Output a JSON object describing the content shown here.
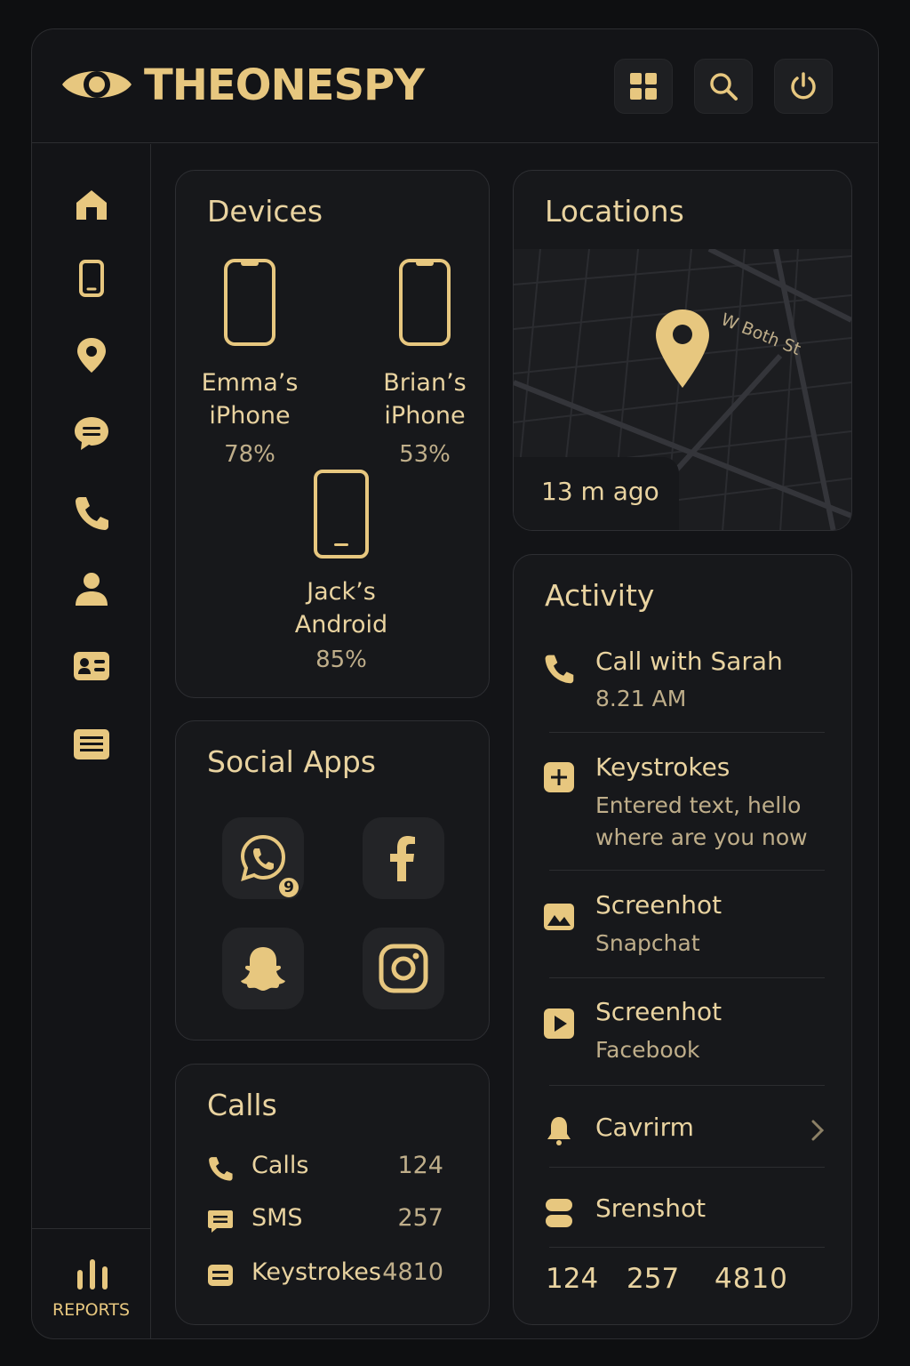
{
  "header": {
    "brand": "THEONESPY",
    "icons": [
      "eye-logo-icon",
      "grid-icon",
      "search-icon",
      "power-icon"
    ]
  },
  "sidebar": {
    "items": [
      "home-icon",
      "phone-icon",
      "location-pin-icon",
      "chat-icon",
      "call-icon",
      "user-icon",
      "contact-card-icon",
      "notes-icon"
    ],
    "reports_label": "REPORTS"
  },
  "devices": {
    "title": "Devices",
    "items": [
      {
        "name_line1": "Emma’s",
        "name_line2": "iPhone",
        "battery": "78%"
      },
      {
        "name_line1": "Brian’s",
        "name_line2": "iPhone",
        "battery": "53%"
      },
      {
        "name_line1": "Jack’s",
        "name_line2": "Android",
        "battery": "85%"
      }
    ]
  },
  "social": {
    "title": "Social Apps",
    "apps": [
      "whatsapp-icon",
      "facebook-icon",
      "snapchat-icon",
      "instagram-icon"
    ],
    "whatsapp_badge": "9"
  },
  "calls": {
    "title": "Calls",
    "rows": [
      {
        "label": "Calls",
        "value": "124"
      },
      {
        "label": "SMS",
        "value": "257"
      },
      {
        "label": "Keystrokes",
        "value": "4810"
      }
    ]
  },
  "locations": {
    "title": "Locations",
    "street": "W Both St",
    "last_seen": "13 m ago"
  },
  "activity": {
    "title": "Activity",
    "items": [
      {
        "title": "Call with Sarah",
        "sub": "8.21 AM"
      },
      {
        "title": "Keystrokes",
        "sub_line1": "Entered text, hello",
        "sub_line2": "where are you now"
      },
      {
        "title": "Screenhot",
        "sub": "Snapchat"
      },
      {
        "title": "Screenhot",
        "sub": "Facebook"
      },
      {
        "title": "Cavrirm"
      },
      {
        "title": "Srenshot"
      }
    ],
    "totals": [
      "124",
      "257",
      "4810"
    ]
  },
  "colors": {
    "accent": "#e7c77f",
    "background": "#0e0f11",
    "panel": "#17181b"
  }
}
